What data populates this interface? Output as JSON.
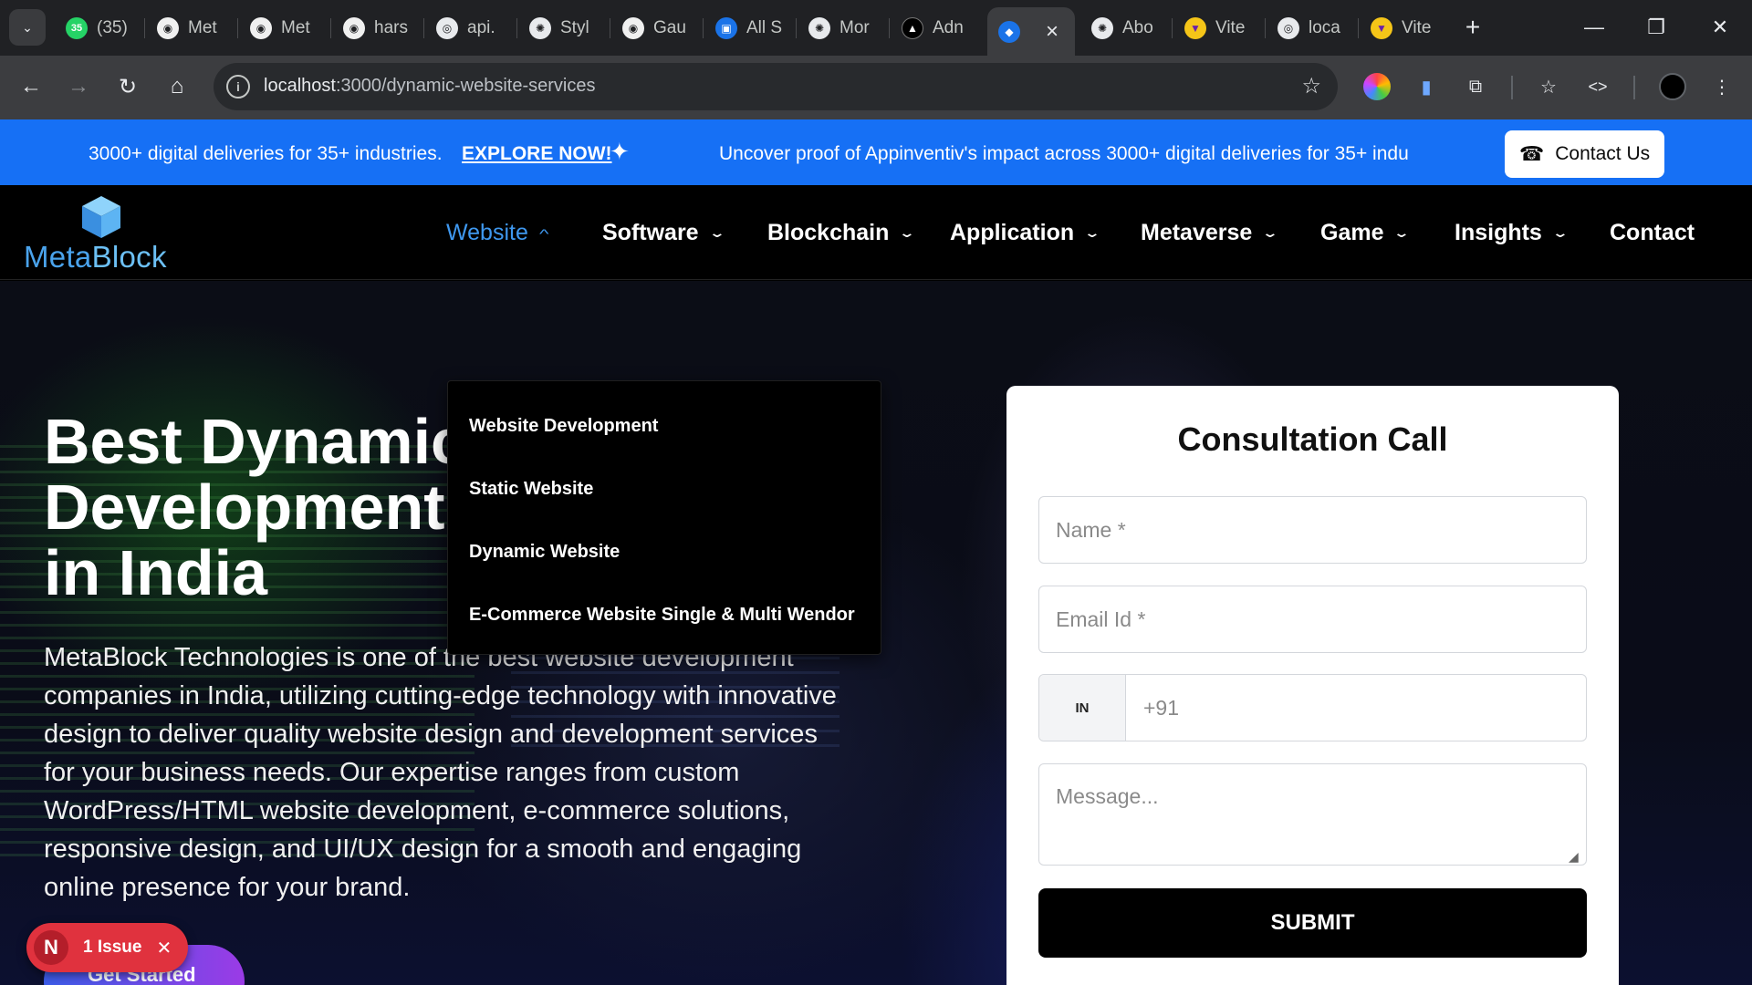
{
  "browser": {
    "tabs": [
      {
        "icon": "whatsapp-icon",
        "badge": "35",
        "title": "(35)"
      },
      {
        "icon": "github-icon",
        "title": "Met"
      },
      {
        "icon": "github-icon",
        "title": "Met"
      },
      {
        "icon": "github-icon",
        "title": "hars"
      },
      {
        "icon": "globe-icon",
        "title": "api."
      },
      {
        "icon": "openai-icon",
        "title": "Styl"
      },
      {
        "icon": "github-icon",
        "title": "Gau"
      },
      {
        "icon": "app-icon",
        "title": "All S"
      },
      {
        "icon": "openai-icon",
        "title": "Mor"
      },
      {
        "icon": "triangle-icon",
        "title": "Adn"
      },
      {
        "icon": "active-tab-icon",
        "title": ""
      },
      {
        "icon": "openai-icon",
        "title": "Abo"
      },
      {
        "icon": "vite-icon",
        "title": "Vite"
      },
      {
        "icon": "globe-icon",
        "title": "loca"
      },
      {
        "icon": "vite-icon",
        "title": "Vite"
      }
    ],
    "url_host": "localhost",
    "url_path": ":3000/dynamic-website-services"
  },
  "announcement": {
    "text": "3000+ digital deliveries for 35+ industries.",
    "link": "EXPLORE NOW!",
    "marquee": "Uncover proof of Appinventiv's impact across 3000+ digital deliveries for 35+ indu",
    "contact_label": "Contact Us"
  },
  "logo": {
    "part1": "Meta",
    "part2": "Block"
  },
  "nav": {
    "items": [
      {
        "label": "Website",
        "active": true
      },
      {
        "label": "Software"
      },
      {
        "label": "Blockchain"
      },
      {
        "label": "Application"
      },
      {
        "label": "Metaverse"
      },
      {
        "label": "Game"
      },
      {
        "label": "Insights"
      },
      {
        "label": "Contact"
      }
    ]
  },
  "dropdown": {
    "items": [
      "Website Development",
      "Static Website",
      "Dynamic Website",
      "E-Commerce Website Single & Multi Wendor"
    ]
  },
  "hero": {
    "title_lines": [
      "Best Dynamic",
      "Development",
      "in India"
    ],
    "description": "MetaBlock Technologies is one of the best website development companies in India, utilizing cutting-edge technology with innovative design to deliver quality website design and development services for your business needs. Our expertise ranges from custom WordPress/HTML website development, e-commerce solutions, responsive design, and UI/UX design for a smooth and engaging online presence for your brand.",
    "cta": "Get Started"
  },
  "form": {
    "title": "Consultation Call",
    "name_placeholder": "Name *",
    "email_placeholder": "Email Id *",
    "country_code": "IN",
    "phone_placeholder": "+91",
    "message_placeholder": "Message...",
    "submit_label": "SUBMIT"
  },
  "dev_overlay": {
    "initial": "N",
    "label": "1 Issue"
  },
  "colors": {
    "accent": "#1670f5",
    "nav_active": "#3f98ef",
    "logo": "#4aa3ec",
    "issue": "#e0323e"
  }
}
